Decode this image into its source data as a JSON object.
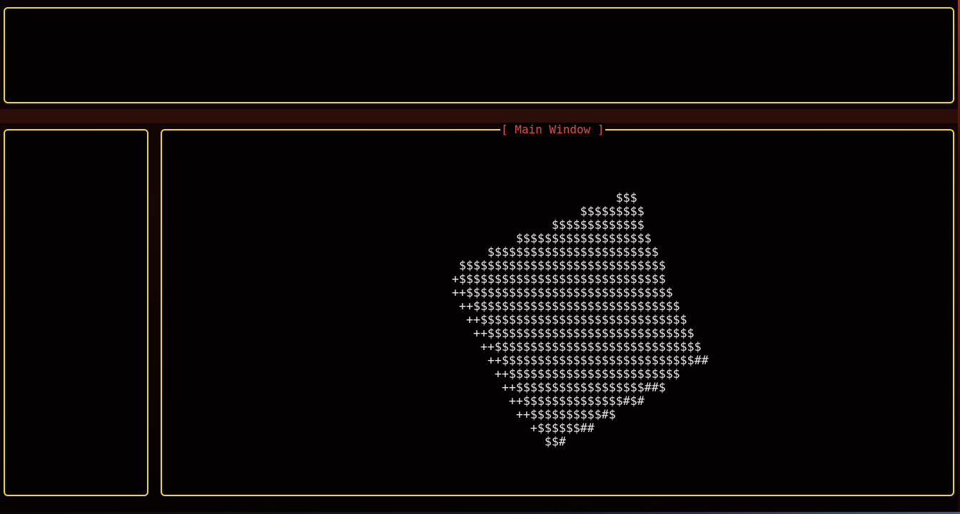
{
  "main_window": {
    "title": "[ Main Window ]",
    "art_lines": [
      "                         $$$",
      "                    $$$$$$$$$",
      "                $$$$$$$$$$$$$",
      "           $$$$$$$$$$$$$$$$$$$",
      "       $$$$$$$$$$$$$$$$$$$$$$$$",
      "   $$$$$$$$$$$$$$$$$$$$$$$$$$$$$",
      "  +$$$$$$$$$$$$$$$$$$$$$$$$$$$$$",
      "  ++$$$$$$$$$$$$$$$$$$$$$$$$$$$$$",
      "   ++$$$$$$$$$$$$$$$$$$$$$$$$$$$$$",
      "    ++$$$$$$$$$$$$$$$$$$$$$$$$$$$$$",
      "     ++$$$$$$$$$$$$$$$$$$$$$$$$$$$$$",
      "      ++$$$$$$$$$$$$$$$$$$$$$$$$$$$$$",
      "       ++$$$$$$$$$$$$$$$$$$$$$$$$$$$##",
      "        ++$$$$$$$$$$$$$$$$$$$$$$$$",
      "         ++$$$$$$$$$$$$$$$$$$##$",
      "          ++$$$$$$$$$$$$$$#$#",
      "           ++$$$$$$$$$$#$",
      "             +$$$$$$##",
      "               $$#"
    ]
  },
  "colors": {
    "panel_border": "#e8da2c",
    "title_text": "#e84848",
    "art_text": "#e9e9e9",
    "background": "#050202"
  }
}
